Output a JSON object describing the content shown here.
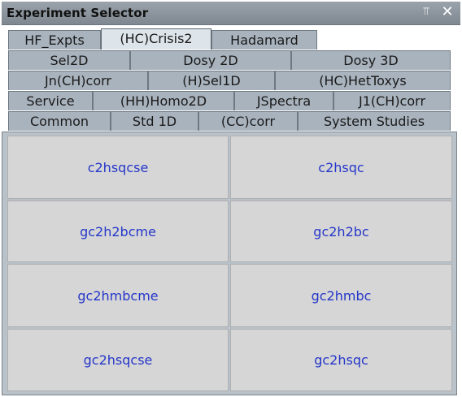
{
  "window": {
    "title": "Experiment Selector",
    "pin_icon": "pin-icon",
    "close_icon": "close-icon"
  },
  "tabs": {
    "row1": [
      "HF_Expts",
      "(HC)Crisis2",
      "Hadamard"
    ],
    "row2": [
      "Sel2D",
      "Dosy 2D",
      "Dosy 3D"
    ],
    "row3": [
      "Jn(CH)corr",
      "(H)Sel1D",
      "(HC)HetToxys"
    ],
    "row4": [
      "Service",
      "(HH)Homo2D",
      "JSpectra",
      "J1(CH)corr"
    ],
    "row5": [
      "Common",
      "Std 1D",
      "(CC)corr",
      "System Studies"
    ],
    "selected": "(HC)Crisis2"
  },
  "experiments": [
    [
      "c2hsqcse",
      "c2hsqc"
    ],
    [
      "gc2h2bcme",
      "gc2h2bc"
    ],
    [
      "gc2hmbcme",
      "gc2hmbc"
    ],
    [
      "gc2hsqcse",
      "gc2hsqc"
    ]
  ],
  "colors": {
    "button_text": "#2436c9",
    "tab_bg": "#a9b3bd",
    "selected_tab_bg": "#dde4ea",
    "panel_bg": "#b9c1c9",
    "button_bg": "#d6d6d6"
  }
}
